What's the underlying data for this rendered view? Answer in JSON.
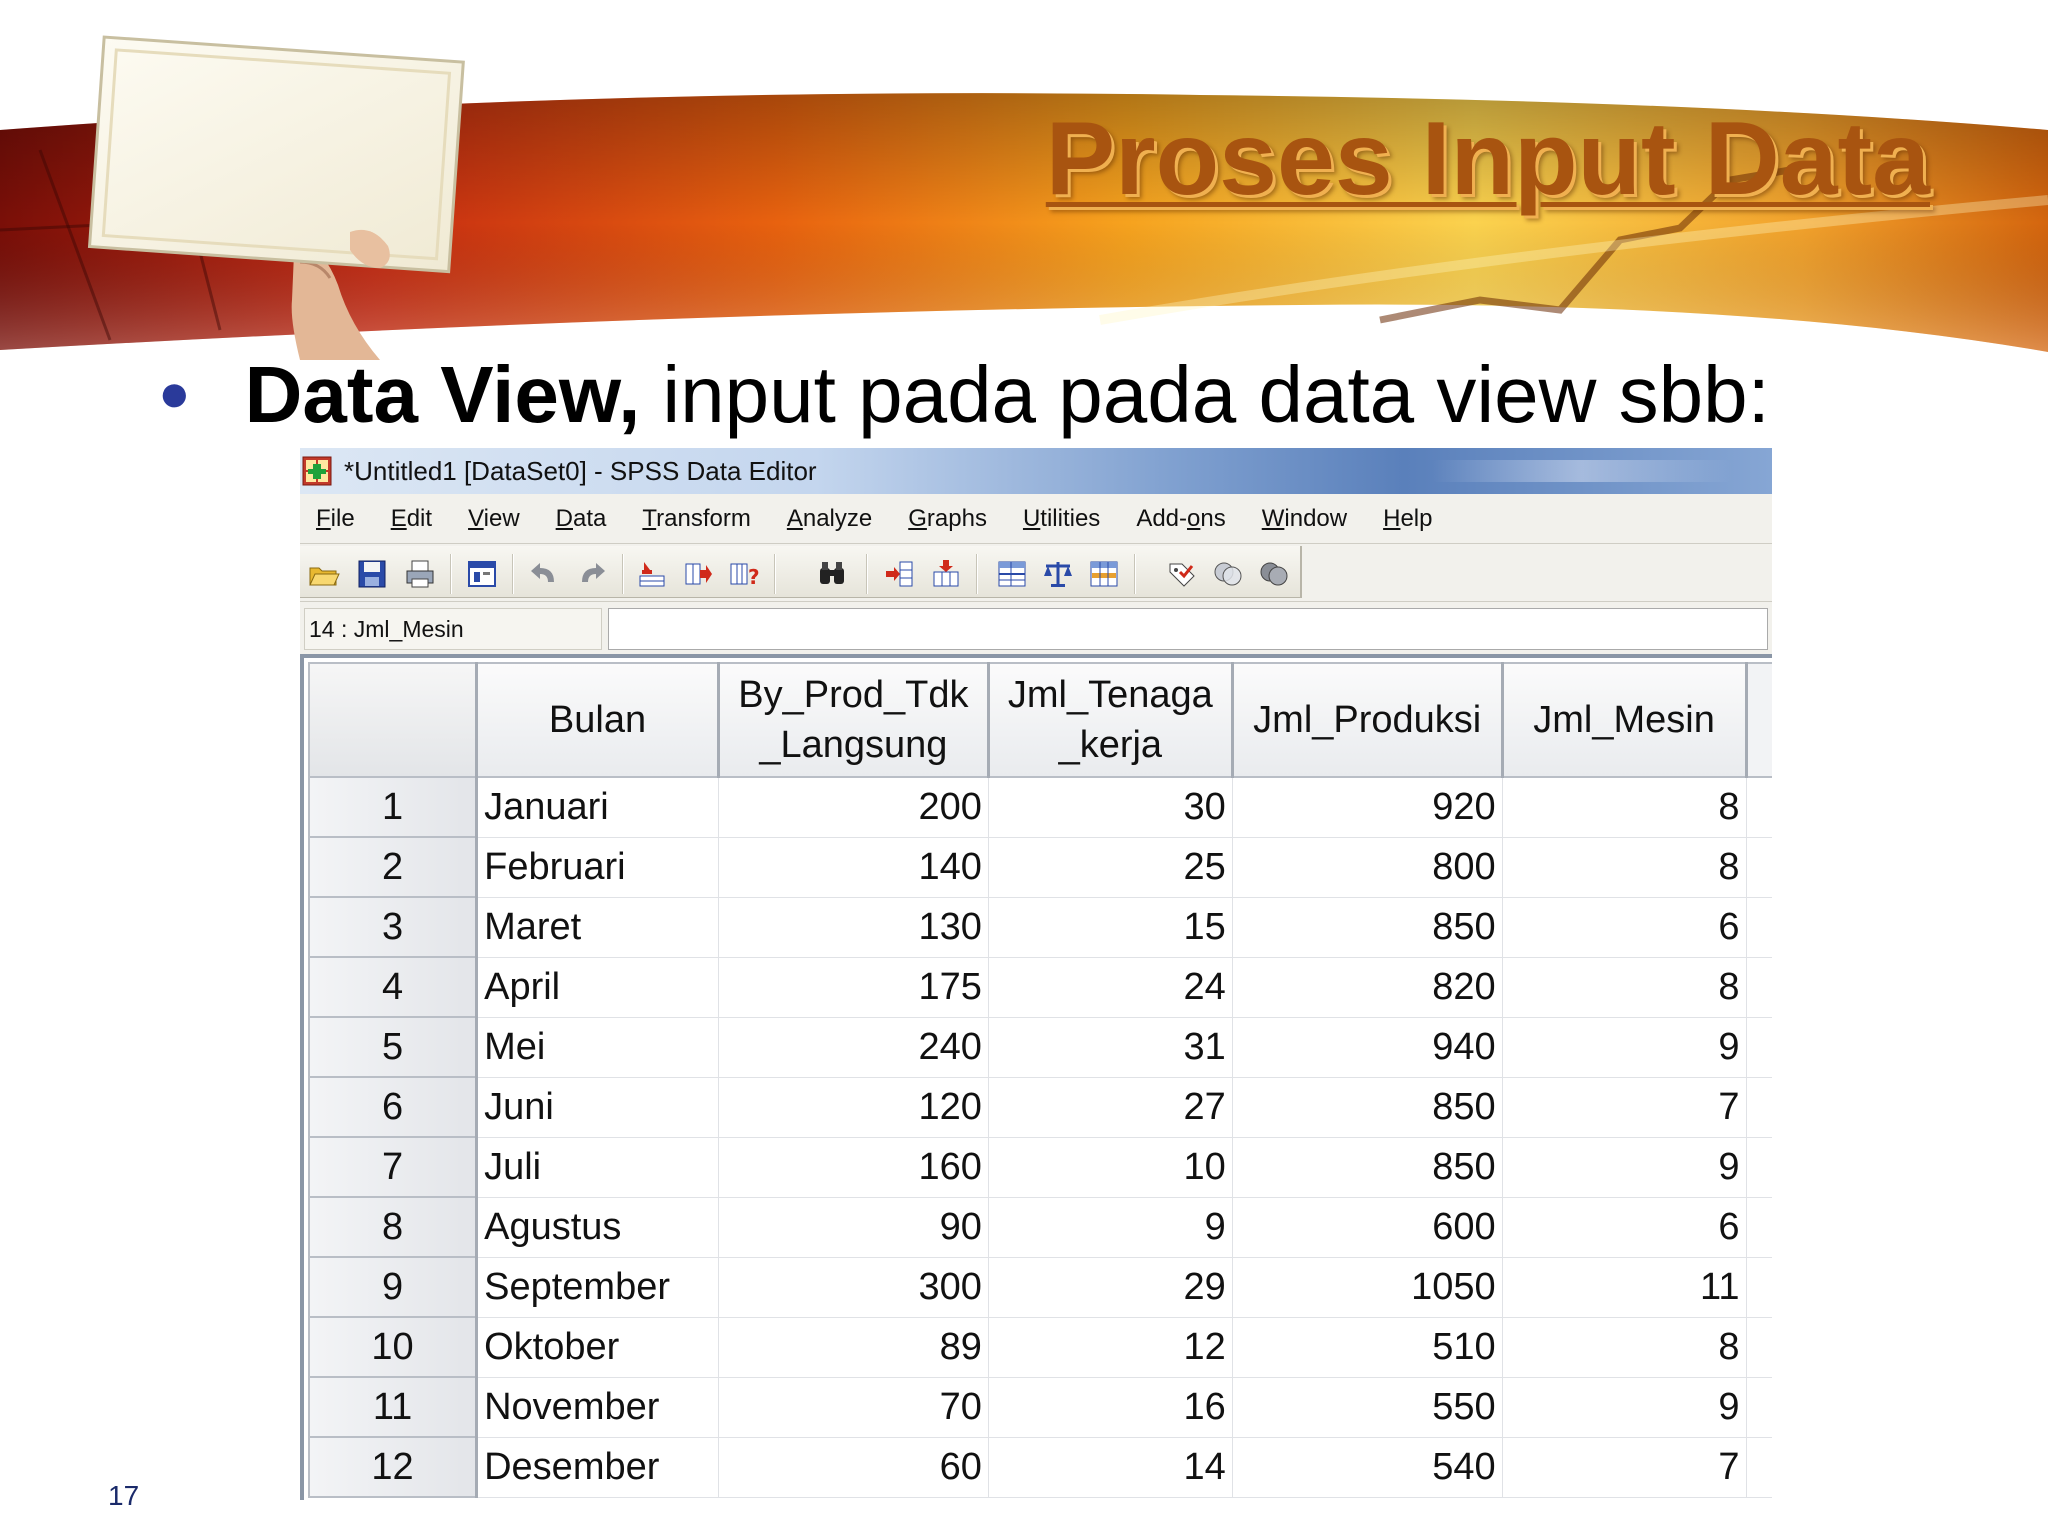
{
  "slide": {
    "title": "Proses Input Data",
    "bullet_bold": "Data View,",
    "bullet_text": "input pada pada data view sbb:",
    "page_number": "17"
  },
  "window": {
    "title": "*Untitled1 [DataSet0] - SPSS Data Editor",
    "menu": [
      {
        "pre": "",
        "ul": "F",
        "post": "ile"
      },
      {
        "pre": "",
        "ul": "E",
        "post": "dit"
      },
      {
        "pre": "",
        "ul": "V",
        "post": "iew"
      },
      {
        "pre": "",
        "ul": "D",
        "post": "ata"
      },
      {
        "pre": "",
        "ul": "T",
        "post": "ransform"
      },
      {
        "pre": "",
        "ul": "A",
        "post": "nalyze"
      },
      {
        "pre": "",
        "ul": "G",
        "post": "raphs"
      },
      {
        "pre": "",
        "ul": "U",
        "post": "tilities"
      },
      {
        "pre": "Add-",
        "ul": "o",
        "post": "ns"
      },
      {
        "pre": "",
        "ul": "W",
        "post": "indow"
      },
      {
        "pre": "",
        "ul": "H",
        "post": "elp"
      }
    ],
    "toolbar_icons": [
      "open-folder-icon",
      "save-icon",
      "print-icon",
      "dialog-recall-icon",
      "undo-icon",
      "redo-icon",
      "goto-case-icon",
      "goto-variable-icon",
      "variables-info-icon",
      "find-icon",
      "insert-cases-icon",
      "insert-variable-icon",
      "split-file-icon",
      "weight-cases-icon",
      "select-cases-icon",
      "value-labels-icon",
      "use-sets-icon",
      "show-all-variables-icon"
    ],
    "cell_reference": "14 : Jml_Mesin",
    "cell_value": ""
  },
  "grid": {
    "columns": [
      {
        "label_line1": "Bulan",
        "label_line2": ""
      },
      {
        "label_line1": "By_Prod_Tdk",
        "label_line2": "_Langsung"
      },
      {
        "label_line1": "Jml_Tenaga",
        "label_line2": "_kerja"
      },
      {
        "label_line1": "Jml_Produksi",
        "label_line2": ""
      },
      {
        "label_line1": "Jml_Mesin",
        "label_line2": ""
      }
    ],
    "rows": [
      {
        "n": "1",
        "cells": [
          "Januari",
          "200",
          "30",
          "920",
          "8"
        ]
      },
      {
        "n": "2",
        "cells": [
          "Februari",
          "140",
          "25",
          "800",
          "8"
        ]
      },
      {
        "n": "3",
        "cells": [
          "Maret",
          "130",
          "15",
          "850",
          "6"
        ]
      },
      {
        "n": "4",
        "cells": [
          "April",
          "175",
          "24",
          "820",
          "8"
        ]
      },
      {
        "n": "5",
        "cells": [
          "Mei",
          "240",
          "31",
          "940",
          "9"
        ]
      },
      {
        "n": "6",
        "cells": [
          "Juni",
          "120",
          "27",
          "850",
          "7"
        ]
      },
      {
        "n": "7",
        "cells": [
          "Juli",
          "160",
          "10",
          "850",
          "9"
        ]
      },
      {
        "n": "8",
        "cells": [
          "Agustus",
          "90",
          "9",
          "600",
          "6"
        ]
      },
      {
        "n": "9",
        "cells": [
          "September",
          "300",
          "29",
          "1050",
          "11"
        ]
      },
      {
        "n": "10",
        "cells": [
          "Oktober",
          "89",
          "12",
          "510",
          "8"
        ]
      },
      {
        "n": "11",
        "cells": [
          "November",
          "70",
          "16",
          "550",
          "9"
        ]
      },
      {
        "n": "12",
        "cells": [
          "Desember",
          "60",
          "14",
          "540",
          "7"
        ]
      }
    ]
  }
}
